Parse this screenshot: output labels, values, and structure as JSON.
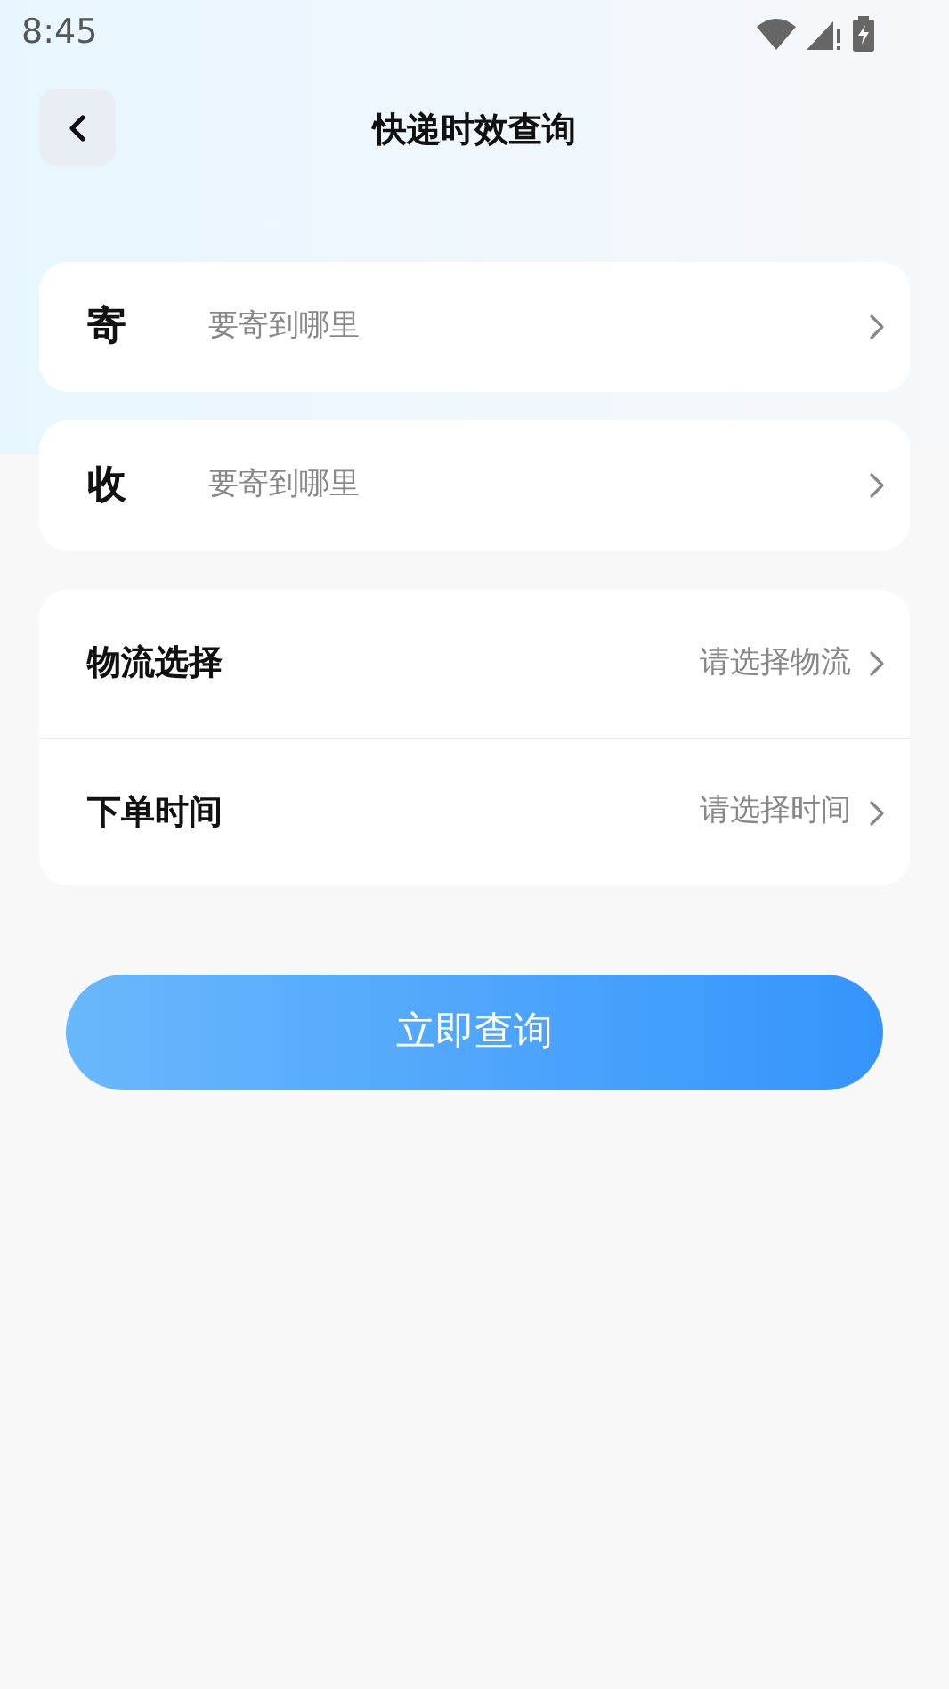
{
  "status_bar": {
    "time": "8:45"
  },
  "header": {
    "title": "快递时效查询"
  },
  "address_rows": [
    {
      "label": "寄",
      "hint": "要寄到哪里"
    },
    {
      "label": "收",
      "hint": "要寄到哪里"
    }
  ],
  "option_rows": [
    {
      "label": "物流选择",
      "hint": "请选择物流"
    },
    {
      "label": "下单时间",
      "hint": "请选择时间"
    }
  ],
  "submit_button": "立即查询"
}
